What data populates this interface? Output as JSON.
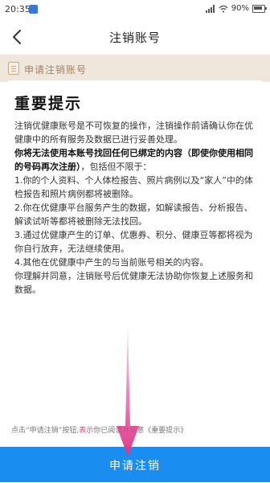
{
  "status_bar": {
    "time": "20:35",
    "battery_text": "90%"
  },
  "nav": {
    "title": "注销账号"
  },
  "apply_bar": {
    "label": "申请注销账号"
  },
  "notice": {
    "title": "重要提示",
    "intro": "注销优健康账号是不可恢复的操作，注销操作前请确认你在优健康中的所有服务及数据已进行妥善处理。",
    "bold_warning": "你将无法使用本账号找回任何已绑定的内容（即使你使用相同的号码再次注册）",
    "bold_tail": "，包括但不限于：",
    "item1": "1.你的个人资料、个人体检报告、照片病例以及“家人”中的体检报告和照片病例都将被删除。",
    "item2": "2.你在优健康平台服务产生的数据，如解读报告、分析报告、解读试听等都将被删除无法找回。",
    "item3": "3.通过优健康产生的订单、优惠券、积分、健康豆等都将视为你自行放弃，无法继续使用。",
    "item4": "4.其他在优健康中产生的与当前账号相关的内容。",
    "closing": "你理解并同意，注销账号后优健康无法协助你恢复上述服务和数据。"
  },
  "footer": {
    "prefix": "点击“申请注销”按钮,",
    "link": "表示",
    "suffix": "你已阅读并同意《重要提示》"
  },
  "action": {
    "submit_label": "申请注销"
  },
  "colors": {
    "primary": "#1a8df0",
    "apply_bar_bg": "#efe7dc",
    "arrow": "#e0388a"
  }
}
